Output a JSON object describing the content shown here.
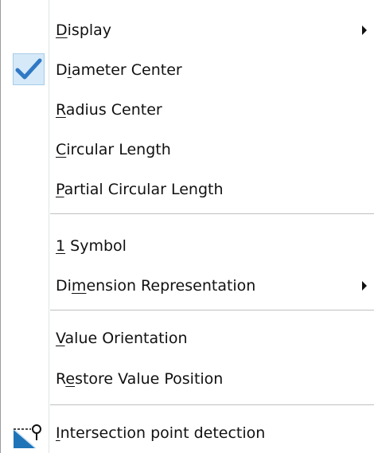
{
  "menu": {
    "items": [
      {
        "pre": "",
        "u": "D",
        "post": "isplay",
        "submenu": true
      },
      {
        "pre": "D",
        "u": "i",
        "post": "ameter Center",
        "checked": true
      },
      {
        "pre": "",
        "u": "R",
        "post": "adius Center"
      },
      {
        "pre": "",
        "u": "C",
        "post": "ircular Length"
      },
      {
        "pre": "",
        "u": "P",
        "post": "artial Circular Length"
      },
      {
        "pre": "",
        "u": "1",
        "post": " Symbol"
      },
      {
        "pre": "Di",
        "u": "m",
        "post": "ension Representation",
        "submenu": true
      },
      {
        "pre": "",
        "u": "V",
        "post": "alue Orientation"
      },
      {
        "pre": "R",
        "u": "e",
        "post": "store Value Position"
      },
      {
        "pre": "",
        "u": "I",
        "post": "ntersection point detection",
        "icon": "intersection-point-icon"
      }
    ]
  },
  "colors": {
    "check_bg": "#d5e9f8",
    "check_mark": "#2f78c4",
    "icon_fill": "#1f74b8"
  }
}
